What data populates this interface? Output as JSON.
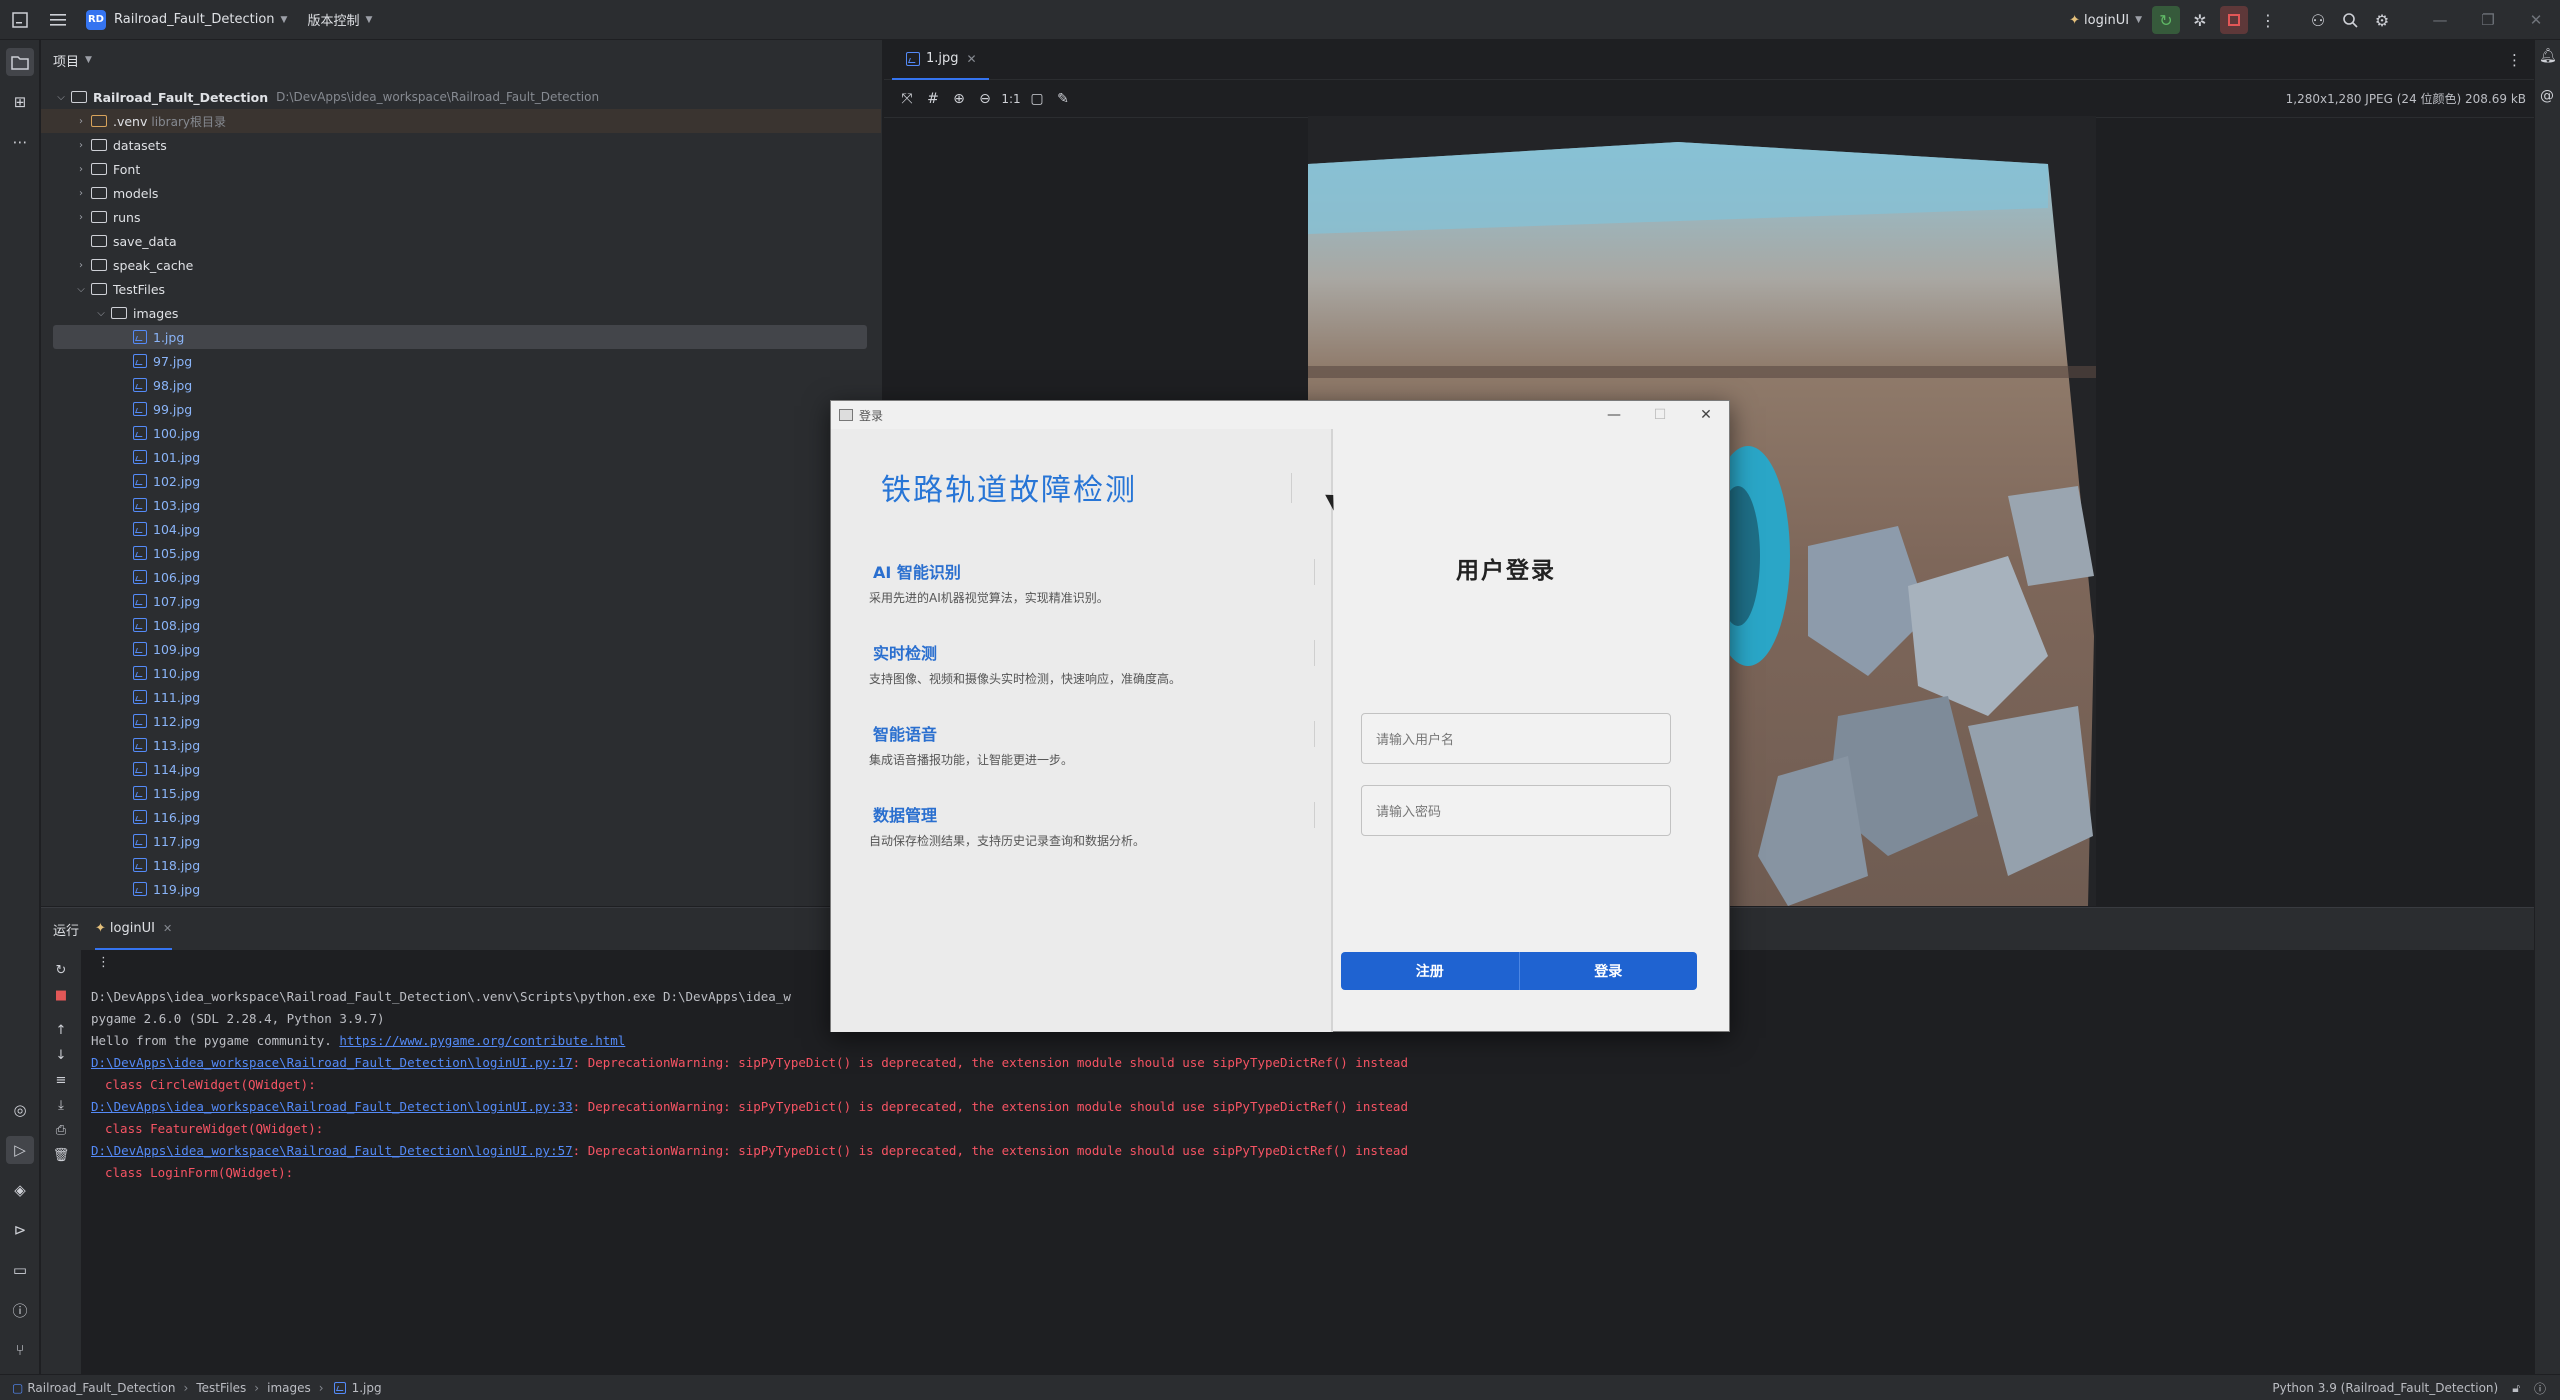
{
  "titlebar": {
    "project_badge": "RD",
    "project_name": "Railroad_Fault_Detection",
    "vcs_menu": "版本控制",
    "run_config": "loginUI"
  },
  "project_panel": {
    "title": "项目",
    "root": {
      "name": "Railroad_Fault_Detection",
      "path": "D:\\DevApps\\idea_workspace\\Railroad_Fault_Detection"
    },
    "venv": {
      "name": ".venv",
      "hint": "library根目录"
    },
    "folders": [
      "datasets",
      "Font",
      "models",
      "runs",
      "save_data",
      "speak_cache",
      "TestFiles",
      "images"
    ],
    "files": [
      "1.jpg",
      "97.jpg",
      "98.jpg",
      "99.jpg",
      "100.jpg",
      "101.jpg",
      "102.jpg",
      "103.jpg",
      "104.jpg",
      "105.jpg",
      "106.jpg",
      "107.jpg",
      "108.jpg",
      "109.jpg",
      "110.jpg",
      "111.jpg",
      "112.jpg",
      "113.jpg",
      "114.jpg",
      "115.jpg",
      "116.jpg",
      "117.jpg",
      "118.jpg",
      "119.jpg"
    ]
  },
  "editor": {
    "tab": "1.jpg",
    "zoom_label": "1:1",
    "image_meta": "1,280x1,280 JPEG (24 位颜色) 208.69 kB"
  },
  "run_panel": {
    "title": "运行",
    "tab": "loginUI",
    "console": {
      "cmd": "D:\\DevApps\\idea_workspace\\Railroad_Fault_Detection\\.venv\\Scripts\\python.exe D:\\DevApps\\idea_w",
      "pygame": "pygame 2.6.0 (SDL 2.28.4, Python 3.9.7)",
      "hello_prefix": "Hello from the pygame community. ",
      "hello_link": "https://www.pygame.org/contribute.html",
      "w1_link": "D:\\DevApps\\idea_workspace\\Railroad_Fault_Detection\\loginUI.py:17",
      "w2_link": "D:\\DevApps\\idea_workspace\\Railroad_Fault_Detection\\loginUI.py:33",
      "w3_link": "D:\\DevApps\\idea_workspace\\Railroad_Fault_Detection\\loginUI.py:57",
      "warn_text": ": DeprecationWarning: sipPyTypeDict() is deprecated, the extension module should use sipPyTypeDictRef() instead",
      "c1": "class CircleWidget(QWidget):",
      "c2": "class FeatureWidget(QWidget):",
      "c3": "class LoginForm(QWidget):"
    }
  },
  "statusbar": {
    "crumbs": [
      "Railroad_Fault_Detection",
      "TestFiles",
      "images",
      "1.jpg"
    ],
    "interpreter": "Python 3.9 (Railroad_Fault_Detection)"
  },
  "dialog": {
    "window_title": "登录",
    "heading": "铁路轨道故障检测",
    "features": [
      {
        "title": "AI 智能识别",
        "desc": "采用先进的AI机器视觉算法，实现精准识别。"
      },
      {
        "title": "实时检测",
        "desc": "支持图像、视频和摄像头实时检测，快速响应，准确度高。"
      },
      {
        "title": "智能语音",
        "desc": "集成语音播报功能，让智能更进一步。"
      },
      {
        "title": "数据管理",
        "desc": "自动保存检测结果，支持历史记录查询和数据分析。"
      }
    ],
    "login_title": "用户登录",
    "username_placeholder": "请输入用户名",
    "password_placeholder": "请输入密码",
    "register_label": "注册",
    "login_label": "登录"
  },
  "colors": {
    "accent": "#3574f0",
    "dialog_heading": "#2775d6",
    "login_button": "#1f63d1",
    "warning_text": "#f75464"
  }
}
